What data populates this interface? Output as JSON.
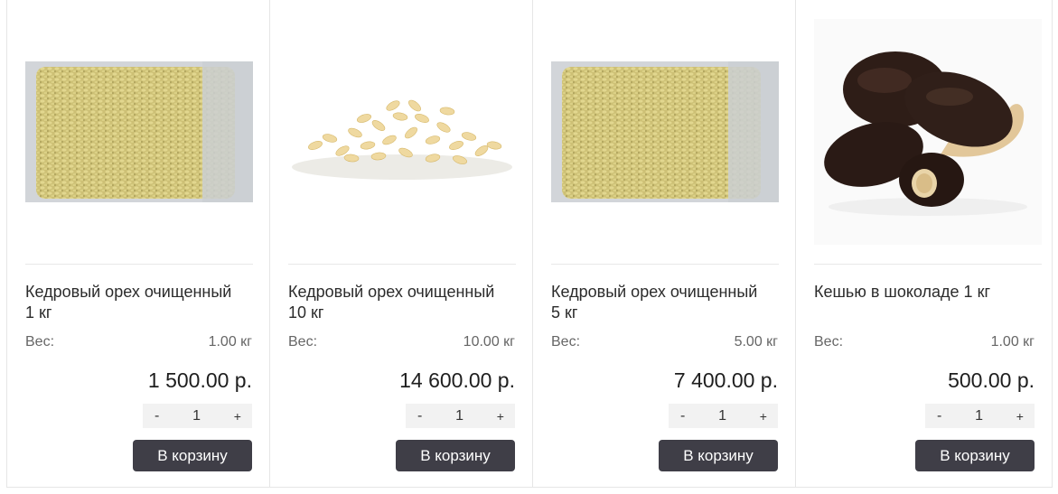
{
  "products": [
    {
      "title": "Кедровый орех очищенный 1 кг",
      "weight_label": "Вес:",
      "weight_value": "1.00 кг",
      "price": "1 500.00 р.",
      "qty_minus": "-",
      "qty_value": "1",
      "qty_plus": "+",
      "button_label": "В корзину"
    },
    {
      "title": "Кедровый орех очищенный 10 кг",
      "weight_label": "Вес:",
      "weight_value": "10.00 кг",
      "price": "14 600.00 р.",
      "qty_minus": "-",
      "qty_value": "1",
      "qty_plus": "+",
      "button_label": "В корзину"
    },
    {
      "title": "Кедровый орех очищенный 5 кг",
      "weight_label": "Вес:",
      "weight_value": "5.00 кг",
      "price": "7 400.00 р.",
      "qty_minus": "-",
      "qty_value": "1",
      "qty_plus": "+",
      "button_label": "В корзину"
    },
    {
      "title": "Кешью в шоколаде 1 кг",
      "weight_label": "Вес:",
      "weight_value": "1.00 кг",
      "price": "500.00 р.",
      "qty_minus": "-",
      "qty_value": "1",
      "qty_plus": "+",
      "button_label": "В корзину"
    }
  ],
  "colors": {
    "button_bg": "#3f3e47",
    "qty_bg": "#f2f2f2",
    "border": "#e6e6e6"
  }
}
